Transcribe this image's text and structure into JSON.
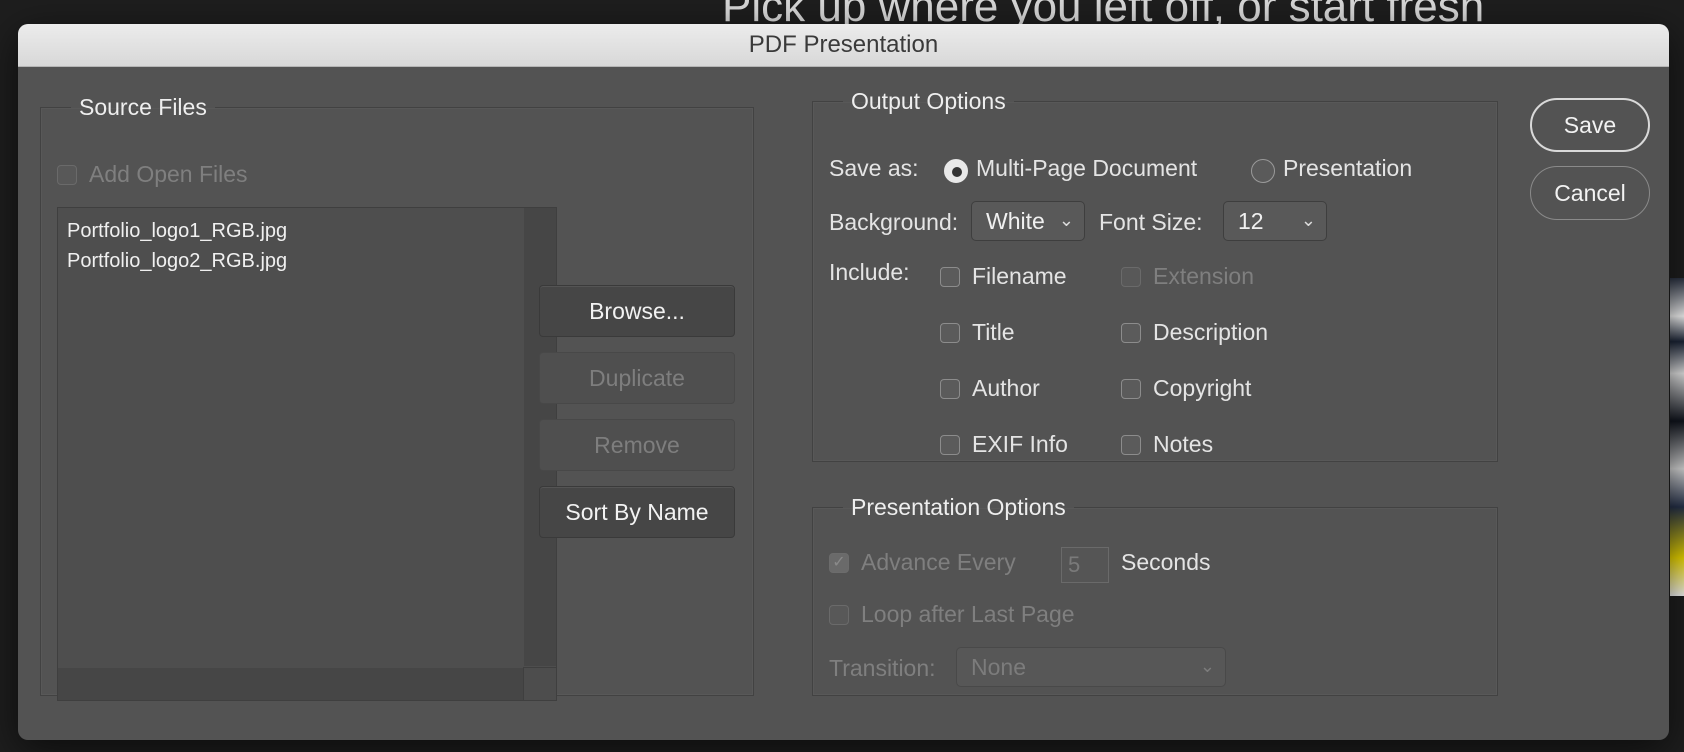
{
  "background": {
    "heading": "Pick up where you left off, or start fresh"
  },
  "dialog": {
    "title": "PDF Presentation",
    "buttons": {
      "save": "Save",
      "cancel": "Cancel"
    }
  },
  "source_files": {
    "legend": "Source Files",
    "add_open_files": {
      "label": "Add Open Files",
      "checked": false,
      "disabled": true
    },
    "files": [
      "Portfolio_logo1_RGB.jpg",
      "Portfolio_logo2_RGB.jpg"
    ],
    "buttons": {
      "browse": "Browse...",
      "duplicate": "Duplicate",
      "remove": "Remove",
      "sort_by_name": "Sort By Name"
    }
  },
  "output_options": {
    "legend": "Output Options",
    "save_as": {
      "label": "Save as:",
      "options": [
        "Multi-Page Document",
        "Presentation"
      ],
      "selected": "Multi-Page Document"
    },
    "background": {
      "label": "Background:",
      "value": "White"
    },
    "font_size": {
      "label": "Font Size:",
      "value": "12"
    },
    "include": {
      "label": "Include:",
      "filename": "Filename",
      "extension": "Extension",
      "title": "Title",
      "description": "Description",
      "author": "Author",
      "copyright": "Copyright",
      "exif_info": "EXIF Info",
      "notes": "Notes"
    }
  },
  "presentation_options": {
    "legend": "Presentation Options",
    "advance_every": {
      "label": "Advance Every",
      "value": "5",
      "unit": "Seconds",
      "checked": true,
      "disabled": true
    },
    "loop_after_last_page": {
      "label": "Loop after Last Page",
      "checked": false,
      "disabled": true
    },
    "transition": {
      "label": "Transition:",
      "value": "None",
      "disabled": true
    }
  }
}
